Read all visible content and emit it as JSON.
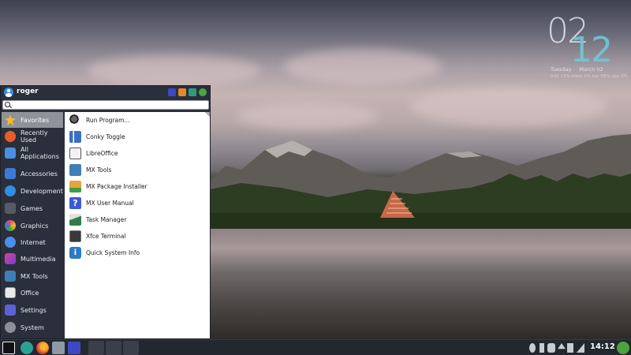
{
  "clock": {
    "hour": "02",
    "minute": "12",
    "day": "Tuesday",
    "date": "March 02",
    "stats": "hdd 13%  mem 1%  bat 58%  cpu 3%"
  },
  "menu": {
    "username": "roger",
    "search_placeholder": "",
    "categories": [
      {
        "label": "Favorites",
        "icon": "star-icon",
        "color": "#f5b82e",
        "active": true
      },
      {
        "label": "Recently Used",
        "icon": "clock-icon",
        "color": "#e85d2a",
        "active": false
      },
      {
        "label": "All Applications",
        "icon": "apps-icon",
        "color": "#4a8fe0",
        "active": false
      },
      {
        "label": "Accessories",
        "icon": "accessories-icon",
        "color": "#3d7ad6",
        "active": false
      },
      {
        "label": "Development",
        "icon": "gear-icon",
        "color": "#2f8de4",
        "active": false
      },
      {
        "label": "Games",
        "icon": "gamepad-icon",
        "color": "#555a64",
        "active": false
      },
      {
        "label": "Graphics",
        "icon": "graphics-icon",
        "color": "#e84c6f",
        "active": false
      },
      {
        "label": "Internet",
        "icon": "globe-icon",
        "color": "#4b8ef0",
        "active": false
      },
      {
        "label": "Multimedia",
        "icon": "multimedia-icon",
        "color": "#d1459a",
        "active": false
      },
      {
        "label": "MX Tools",
        "icon": "mx-tools-icon",
        "color": "#3e7fb8",
        "active": false
      },
      {
        "label": "Office",
        "icon": "office-icon",
        "color": "#e9e9e9",
        "active": false
      },
      {
        "label": "Settings",
        "icon": "settings-icon",
        "color": "#5b62d6",
        "active": false
      },
      {
        "label": "System",
        "icon": "system-icon",
        "color": "#8a8f98",
        "active": false
      }
    ],
    "apps": [
      {
        "label": "Run Program...",
        "icon": "run-program-icon",
        "color": "#444444"
      },
      {
        "label": "Conky Toggle",
        "icon": "conky-icon",
        "color": "#3a6fc4"
      },
      {
        "label": "LibreOffice",
        "icon": "libreoffice-icon",
        "color": "#f2f2f2"
      },
      {
        "label": "MX Tools",
        "icon": "mx-tools-icon",
        "color": "#3e7fb8"
      },
      {
        "label": "MX Package Installer",
        "icon": "package-installer-icon",
        "color": "#e8a33a"
      },
      {
        "label": "MX User Manual",
        "icon": "help-icon",
        "color": "#3b5bd6"
      },
      {
        "label": "Task Manager",
        "icon": "task-manager-icon",
        "color": "#2f7d4a"
      },
      {
        "label": "Xfce Terminal",
        "icon": "terminal-icon",
        "color": "#3a3a3a"
      },
      {
        "label": "Quick System Info",
        "icon": "info-icon",
        "color": "#2a7cc7"
      }
    ]
  },
  "taskbar": {
    "time": "14:12"
  }
}
